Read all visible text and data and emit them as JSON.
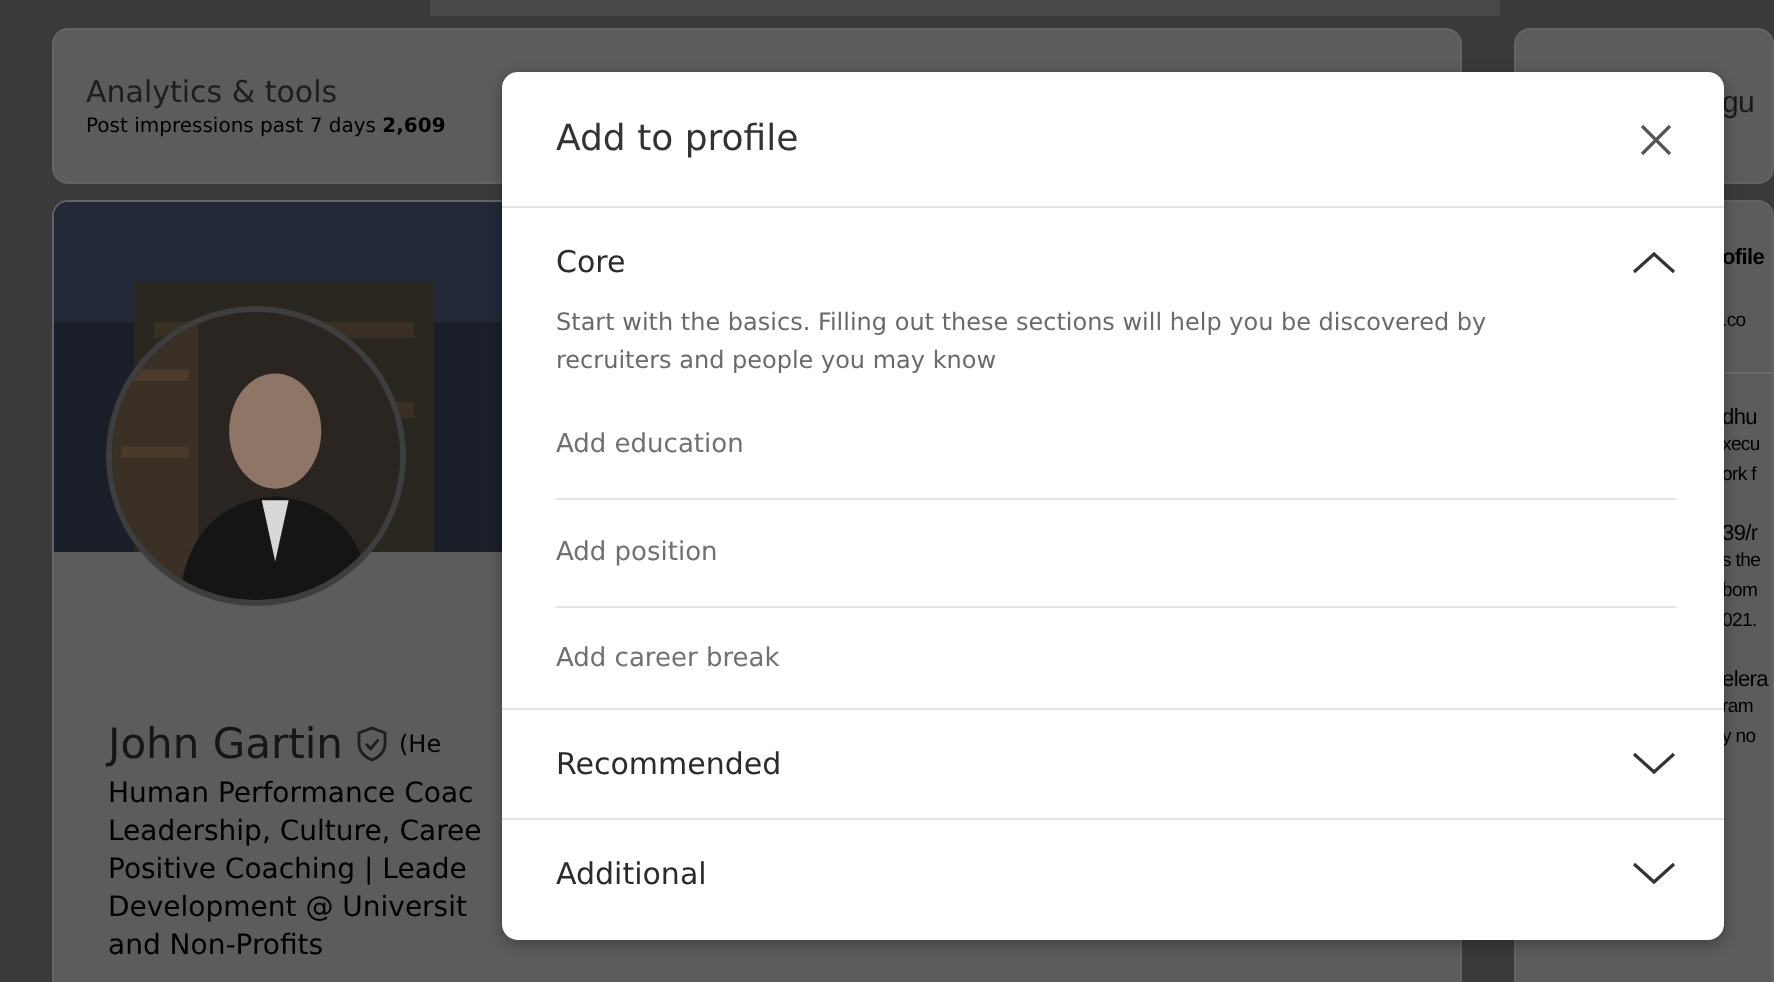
{
  "background": {
    "analytics": {
      "title": "Analytics & tools",
      "subtitle": "Post impressions past 7 days **2,609**"
    },
    "profile": {
      "name": "John Gartin",
      "pronouns": "(He",
      "headline": [
        "Human Performance Coac",
        "Leadership, Culture, Caree",
        "Positive Coaching | Leade",
        "Development @ Universit",
        "and Non-Profits"
      ]
    },
    "right_column": {
      "title": "gu",
      "blocks": [
        {
          "kind": "heading",
          "lines": [
            "ofile"
          ]
        },
        {
          "kind": "small",
          "lines": [
            ".co"
          ]
        },
        {
          "kind": "divider"
        },
        {
          "kind": "name",
          "lines": [
            "dhu"
          ]
        },
        {
          "kind": "small",
          "lines": [
            "xecu",
            "ork f"
          ]
        },
        {
          "kind": "name",
          "lines": [
            "39/r"
          ]
        },
        {
          "kind": "small",
          "lines": [
            "s the",
            "bom",
            "021."
          ]
        },
        {
          "kind": "name",
          "lines": [
            "elera"
          ]
        },
        {
          "kind": "small",
          "lines": [
            "ram",
            "y no"
          ]
        }
      ]
    }
  },
  "dialog": {
    "title": "Add to profile",
    "sections": [
      {
        "title": "Core",
        "expanded": true,
        "description": "Start with the basics. Filling out these sections will help you be discovered by recruiters and people you may know",
        "items": [
          "Add education",
          "Add position",
          "Add career break"
        ]
      },
      {
        "title": "Recommended",
        "expanded": false
      },
      {
        "title": "Additional",
        "expanded": false
      }
    ]
  }
}
